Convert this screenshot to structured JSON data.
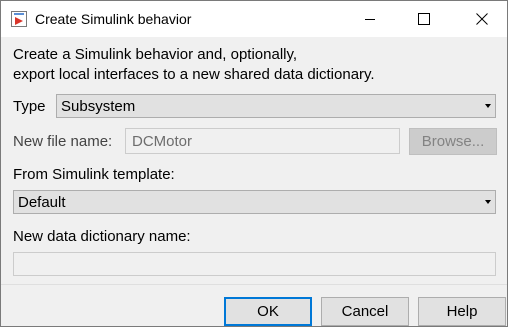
{
  "window": {
    "title": "Create Simulink behavior"
  },
  "description": {
    "line1": "Create a Simulink behavior and, optionally,",
    "line2": "export local interfaces to a new shared data dictionary."
  },
  "type_field": {
    "label": "Type",
    "value": "Subsystem"
  },
  "file_name_field": {
    "label": "New file name:",
    "value": "DCMotor",
    "browse_label": "Browse..."
  },
  "template_field": {
    "label": "From Simulink template:",
    "value": "Default"
  },
  "dictionary_field": {
    "label": "New data dictionary name:",
    "value": ""
  },
  "footer": {
    "ok_label": "OK",
    "cancel_label": "Cancel",
    "help_label": "Help"
  },
  "colors": {
    "accent": "#0078d7",
    "dialog_bg": "#f0f0f0",
    "combo_bg": "#e1e1e1"
  },
  "icons": [
    "simulink-app-icon",
    "minimize-icon",
    "maximize-icon",
    "close-icon",
    "dropdown-arrow-icon"
  ]
}
